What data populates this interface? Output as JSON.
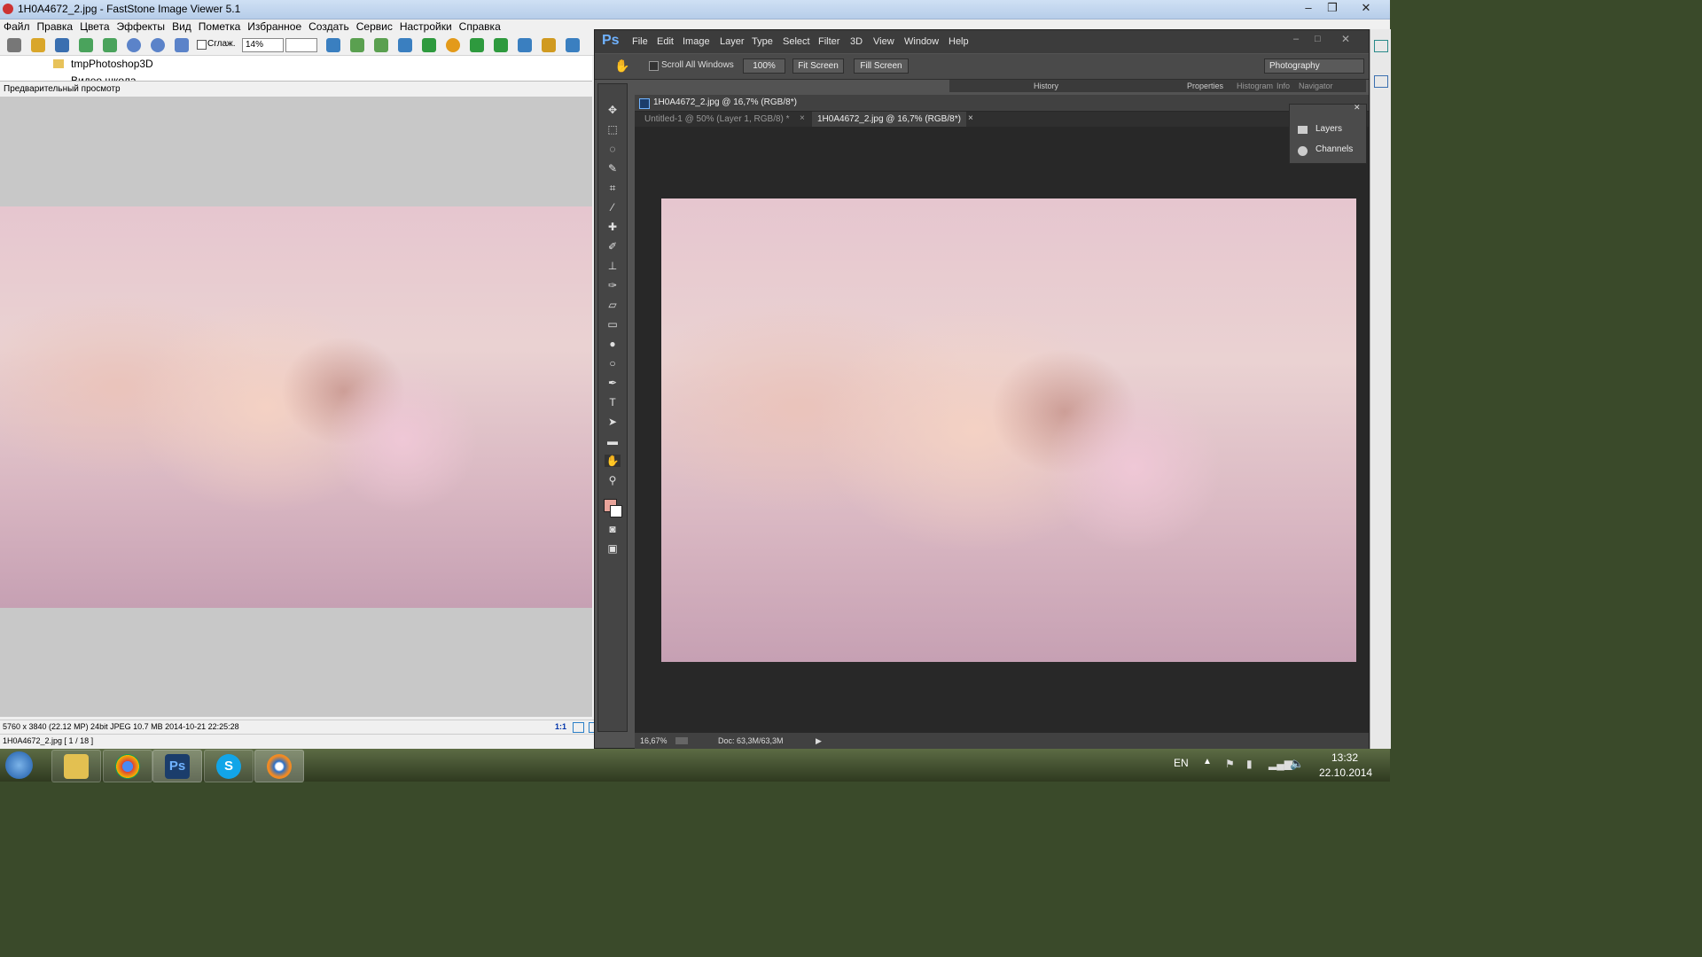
{
  "fs": {
    "title": "1H0A4672_2.jpg  -  FastStone Image Viewer 5.1",
    "menu": [
      "Файл",
      "Правка",
      "Цвета",
      "Эффекты",
      "Вид",
      "Пометка",
      "Избранное",
      "Создать",
      "Сервис",
      "Настройки",
      "Справка"
    ],
    "smoothing_label": "Сглаж.",
    "zoom_value": "14%",
    "tree_item": "tmpPhotoshop3D",
    "tree_item_partial": "Видео школа",
    "preview_label": "Предварительный просмотр",
    "status_info": "5760 x 3840 (22.12 MP)  24bit  JPEG   10.7 MB   2014-10-21 22:25:28",
    "status_ratio": "1:1",
    "status_file": "1H0A4672_2.jpg [ 1 / 18 ]"
  },
  "ps": {
    "logo": "Ps",
    "menu": [
      "File",
      "Edit",
      "Image",
      "Layer",
      "Type",
      "Select",
      "Filter",
      "3D",
      "View",
      "Window",
      "Help"
    ],
    "scroll_all_windows": "Scroll All Windows",
    "btn_100": "100%",
    "btn_fit_screen": "Fit Screen",
    "btn_fill_screen": "Fill Screen",
    "workspace": "Photography",
    "doc_title": "1H0A4672_2.jpg @ 16,7% (RGB/8*)",
    "tab1": "Untitled-1 @ 50% (Layer 1, RGB/8) *",
    "tab2": "1H0A4672_2.jpg @ 16,7% (RGB/8*)",
    "zoom_status": "16,67%",
    "doc_size": "Doc: 63,3M/63,3M",
    "panel_tabs": [
      "History",
      "Properties",
      "Histogram",
      "Info",
      "Navigator"
    ],
    "layers_label": "Layers",
    "channels_label": "Channels"
  },
  "taskbar": {
    "lang": "EN",
    "time": "13:32",
    "date": "22.10.2014",
    "ps_icon": "Ps",
    "skype_icon": "S"
  }
}
